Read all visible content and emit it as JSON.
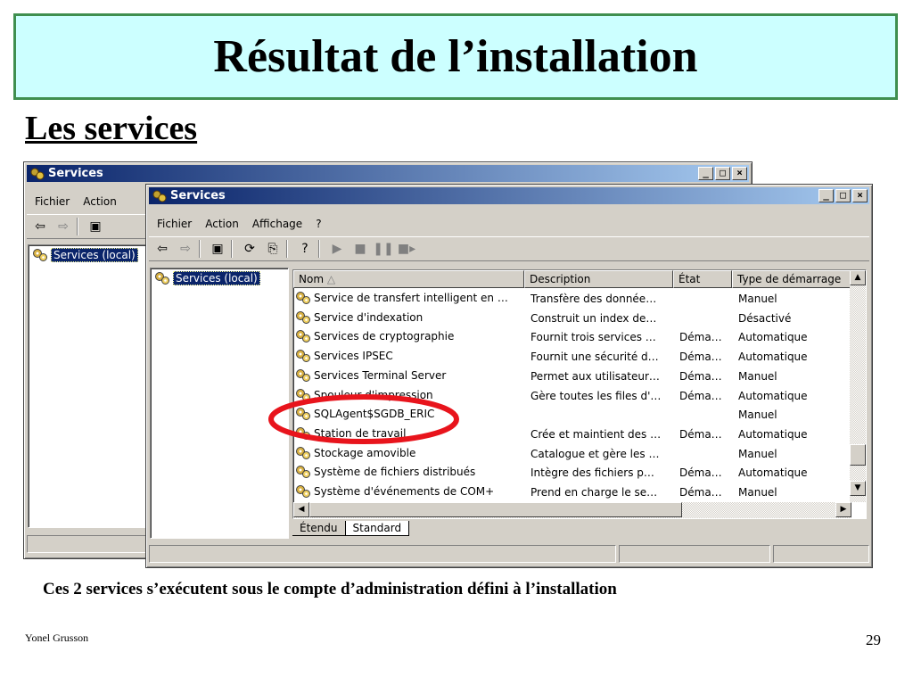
{
  "slide": {
    "title": "Résultat de l’installation",
    "subtitle": "Les services",
    "caption": "Ces 2 services s’exécutent sous le compte d’administration défini à l’installation",
    "author": "Yonel Grusson",
    "page_number": "29"
  },
  "back_window": {
    "title": "Services",
    "menu": [
      "Fichier",
      "Action"
    ],
    "tree_item": "Services (local)"
  },
  "front_window": {
    "title": "Services",
    "menu": [
      "Fichier",
      "Action",
      "Affichage",
      "?"
    ],
    "tree_item": "Services (local)",
    "columns": [
      "Nom",
      "Description",
      "État",
      "Type de démarrage"
    ],
    "rows": [
      {
        "name": "Service de transfert intelligent en …",
        "desc": "Transfère des donnée…",
        "state": "",
        "type": "Manuel"
      },
      {
        "name": "Service d'indexation",
        "desc": "Construit un index de…",
        "state": "",
        "type": "Désactivé"
      },
      {
        "name": "Services de cryptographie",
        "desc": "Fournit trois services …",
        "state": "Déma…",
        "type": "Automatique"
      },
      {
        "name": "Services IPSEC",
        "desc": "Fournit une sécurité d…",
        "state": "Déma…",
        "type": "Automatique"
      },
      {
        "name": "Services Terminal Server",
        "desc": "Permet aux utilisateur…",
        "state": "Déma…",
        "type": "Manuel"
      },
      {
        "name": "Spouleur d'impression",
        "desc": "Gère toutes les files d'…",
        "state": "Déma…",
        "type": "Automatique"
      },
      {
        "name": "SQLAgent$SGDB_ERIC",
        "desc": "",
        "state": "",
        "type": "Manuel"
      },
      {
        "name": "Station de travail",
        "desc": "Crée et maintient des …",
        "state": "Déma…",
        "type": "Automatique"
      },
      {
        "name": "Stockage amovible",
        "desc": "Catalogue et gère les …",
        "state": "",
        "type": "Manuel"
      },
      {
        "name": "Système de fichiers distribués",
        "desc": "Intègre des fichiers p…",
        "state": "Déma…",
        "type": "Automatique"
      },
      {
        "name": "Système d'événements de COM+",
        "desc": "Prend en charge le se…",
        "state": "Déma…",
        "type": "Manuel"
      }
    ],
    "tabs": [
      "Étendu",
      "Standard"
    ],
    "highlight_color": "#e8141c"
  }
}
